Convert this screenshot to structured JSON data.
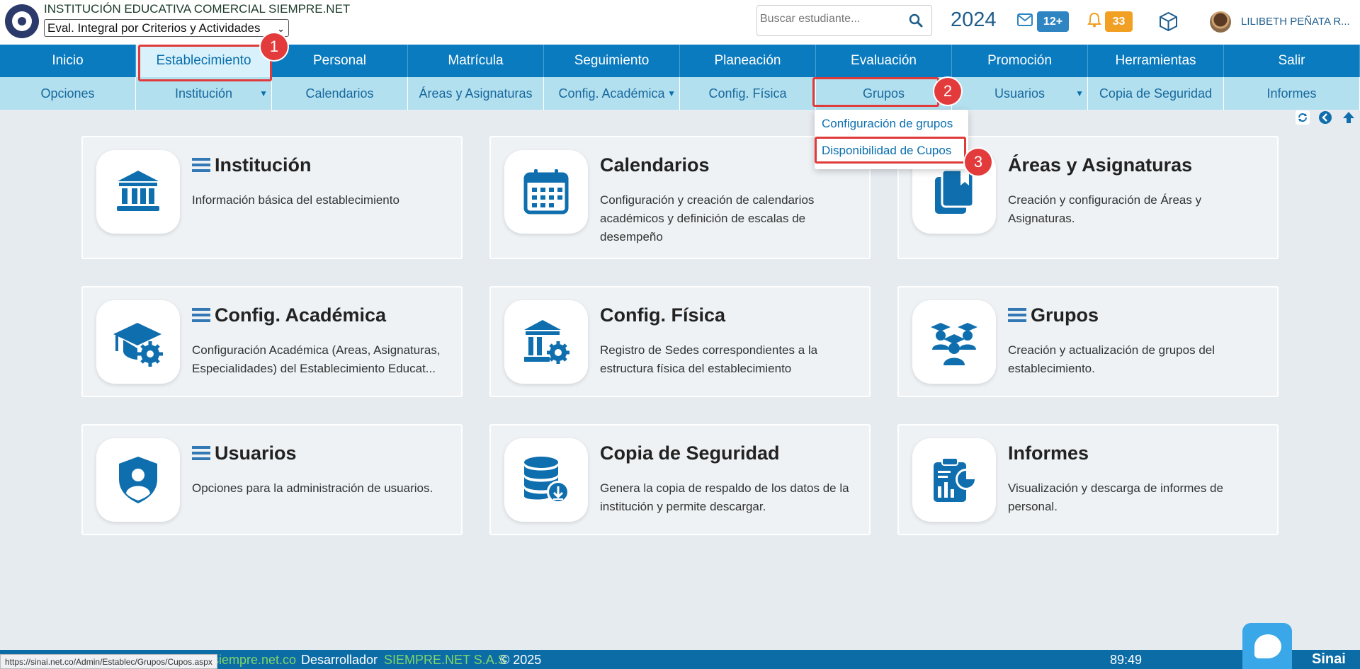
{
  "header": {
    "institution": "INSTITUCIÓN EDUCATIVA COMERCIAL SIEMPRE.NET",
    "mode_select": "Eval. Integral por Criterios y Actividades",
    "search_placeholder": "Buscar estudiante...",
    "year": "2024",
    "mail_badge": "12+",
    "notification_badge": "33",
    "user_name": "LILIBETH PEÑATA R..."
  },
  "main_nav": [
    "Inicio",
    "Establecimiento",
    "Personal",
    "Matrícula",
    "Seguimiento",
    "Planeación",
    "Evaluación",
    "Promoción",
    "Herramientas",
    "Salir"
  ],
  "main_nav_active": "Establecimiento",
  "sub_nav": [
    "Opciones",
    "Institución",
    "Calendarios",
    "Áreas y Asignaturas",
    "Config. Académica",
    "Config. Física",
    "Grupos",
    "Usuarios",
    "Copia de Seguridad",
    "Informes"
  ],
  "dropdown": {
    "items": [
      "Configuración de grupos",
      "Disponibilidad de Cupos"
    ]
  },
  "annotations": [
    "1",
    "2",
    "3"
  ],
  "cards": [
    {
      "title": "Institución",
      "desc": "Información básica del establecimiento",
      "icon": "institution-icon"
    },
    {
      "title": "Calendarios",
      "desc": "Configuración y creación de calendarios académicos y definición de escalas de desempeño",
      "icon": "calendar-icon"
    },
    {
      "title": "Áreas y Asignaturas",
      "desc": "Creación y configuración de Áreas y Asignaturas.",
      "icon": "book-icon"
    },
    {
      "title": "Config. Académica",
      "desc": "Configuración Académica (Areas, Asignaturas, Especialidades) del Establecimiento Educat...",
      "icon": "academic-gear-icon"
    },
    {
      "title": "Config. Física",
      "desc": "Registro de Sedes correspondientes a la estructura física del establecimiento",
      "icon": "building-gear-icon"
    },
    {
      "title": "Grupos",
      "desc": "Creación y actualización de grupos del establecimiento.",
      "icon": "groups-icon"
    },
    {
      "title": "Usuarios",
      "desc": "Opciones para la administración de usuarios.",
      "icon": "user-shield-icon"
    },
    {
      "title": "Copia de Seguridad",
      "desc": "Genera la copia de respaldo de los datos de la institución y permite descargar.",
      "icon": "database-download-icon"
    },
    {
      "title": "Informes",
      "desc": "Visualización y descarga de informes de personal.",
      "icon": "report-icon"
    }
  ],
  "footer": {
    "status_url": "https://sinai.net.co/Admin/Establec/Grupos/Cupos.aspx",
    "site": "siempre.net.co",
    "developer_label": "Desarrollador",
    "company": "SIEMPRE.NET S.A.S",
    "copyright": "© 2025",
    "timer": "89:49",
    "brand": "Sinai"
  },
  "colors": {
    "nav_blue": "#0a7bbf",
    "subnav": "#b3e0ef",
    "highlight_red": "#e03a3a",
    "icon_blue": "#0f6fae"
  }
}
